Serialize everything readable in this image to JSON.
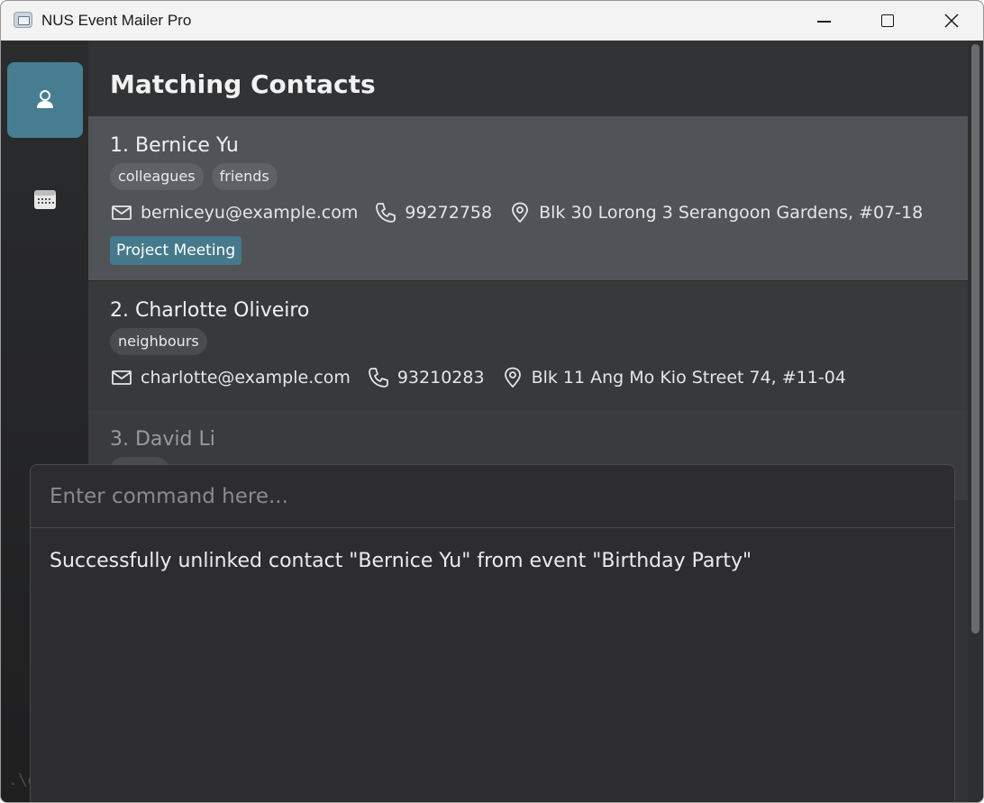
{
  "window": {
    "title": "NUS Event Mailer Pro"
  },
  "sidebar": {
    "items": [
      {
        "icon": "person-icon",
        "active": true
      },
      {
        "icon": "calendar-icon",
        "active": false
      }
    ],
    "footer_text": ".\\d"
  },
  "panel": {
    "title": "Matching Contacts",
    "contacts": [
      {
        "name": "1. Bernice Yu",
        "tags": [
          "colleagues",
          "friends"
        ],
        "email": "berniceyu@example.com",
        "phone": "99272758",
        "address": "Blk 30 Lorong 3 Serangoon Gardens, #07-18",
        "events": [
          "Project Meeting"
        ],
        "selected": true
      },
      {
        "name": "2. Charlotte Oliveiro",
        "tags": [
          "neighbours"
        ],
        "email": "charlotte@example.com",
        "phone": "93210283",
        "address": "Blk 11 Ang Mo Kio Street 74, #11-04",
        "events": []
      },
      {
        "name": "3. David Li",
        "tags": [
          ""
        ]
      }
    ]
  },
  "command": {
    "placeholder": "Enter command here...",
    "value": "",
    "result": "Successfully unlinked contact \"Bernice Yu\" from event \"Birthday Party\""
  },
  "colors": {
    "accent": "#467d91",
    "selected_card": "#505459",
    "background": "#323335"
  }
}
